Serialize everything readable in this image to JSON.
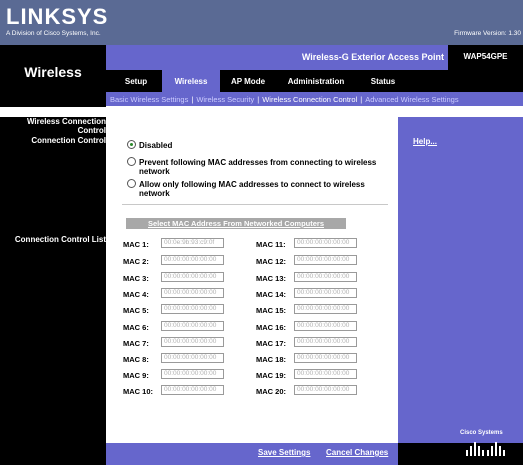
{
  "header": {
    "logo": "LINKSYS",
    "logo_sub": "A Division of Cisco Systems, Inc.",
    "firmware": "Firmware Version: 1.30",
    "section_title": "Wireless",
    "product_name": "Wireless-G Exterior Access Point",
    "model": "WAP54GPE"
  },
  "tabs": [
    {
      "label": "Setup"
    },
    {
      "label": "Wireless"
    },
    {
      "label": "AP Mode"
    },
    {
      "label": "Administration"
    },
    {
      "label": "Status"
    }
  ],
  "subtabs": [
    {
      "label": "Basic Wireless Settings"
    },
    {
      "label": "Wireless Security"
    },
    {
      "label": "Wireless Connection Control"
    },
    {
      "label": "Advanced Wireless Settings"
    }
  ],
  "left": {
    "heading_line1": "Wireless Connection",
    "heading_line2": "Control",
    "connection_control": "Connection Control",
    "connection_control_list": "Connection Control List"
  },
  "radios": {
    "disabled": "Disabled",
    "prevent": "Prevent following MAC addresses from connecting to wireless",
    "prevent_line2": "network",
    "allow": "Allow only following MAC addresses to connect to wireless",
    "allow_line2": "network"
  },
  "select_mac_label": "Select MAC Address From Networked Computers",
  "mac_entries": [
    {
      "label": "MAC 1:",
      "value": "00:0e:9b:93:c9:0f"
    },
    {
      "label": "MAC 2:",
      "value": "00:00:00:00:00:00"
    },
    {
      "label": "MAC 3:",
      "value": "00:00:00:00:00:00"
    },
    {
      "label": "MAC 4:",
      "value": "00:00:00:00:00:00"
    },
    {
      "label": "MAC 5:",
      "value": "00:00:00:00:00:00"
    },
    {
      "label": "MAC 6:",
      "value": "00:00:00:00:00:00"
    },
    {
      "label": "MAC 7:",
      "value": "00:00:00:00:00:00"
    },
    {
      "label": "MAC 8:",
      "value": "00:00:00:00:00:00"
    },
    {
      "label": "MAC 9:",
      "value": "00:00:00:00:00:00"
    },
    {
      "label": "MAC 10:",
      "value": "00:00:00:00:00:00"
    },
    {
      "label": "MAC 11:",
      "value": "00:00:00:00:00:00"
    },
    {
      "label": "MAC 12:",
      "value": "00:00:00:00:00:00"
    },
    {
      "label": "MAC 13:",
      "value": "00:00:00:00:00:00"
    },
    {
      "label": "MAC 14:",
      "value": "00:00:00:00:00:00"
    },
    {
      "label": "MAC 15:",
      "value": "00:00:00:00:00:00"
    },
    {
      "label": "MAC 16:",
      "value": "00:00:00:00:00:00"
    },
    {
      "label": "MAC 17:",
      "value": "00:00:00:00:00:00"
    },
    {
      "label": "MAC 18:",
      "value": "00:00:00:00:00:00"
    },
    {
      "label": "MAC 19:",
      "value": "00:00:00:00:00:00"
    },
    {
      "label": "MAC 20:",
      "value": "00:00:00:00:00:00"
    }
  ],
  "help_link": "Help...",
  "buttons": {
    "save": "Save Settings",
    "cancel": "Cancel Changes"
  },
  "footer": {
    "cisco": "Cisco Systems"
  },
  "colors": {
    "header_slate": "#5a6a94",
    "purple": "#6666cc",
    "black": "#000000"
  }
}
